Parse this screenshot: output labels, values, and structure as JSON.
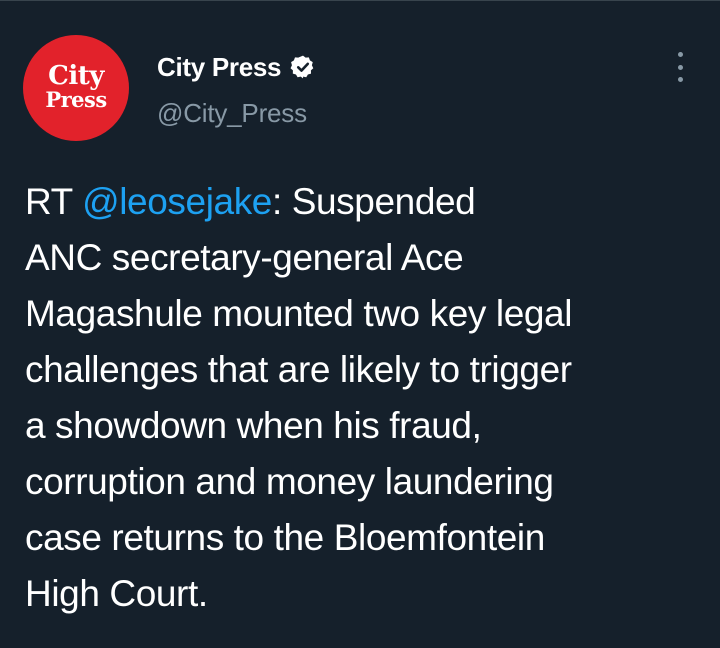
{
  "author": {
    "avatar_line1": "City",
    "avatar_line2": "Press",
    "display_name": "City Press",
    "handle": "@City_Press",
    "verified": true,
    "verified_icon": "verified-badge-icon"
  },
  "menu": {
    "icon": "more-vertical-icon"
  },
  "tweet": {
    "prefix": "RT ",
    "mention": "@leosejake",
    "after_mention": ": Suspended",
    "lines": [
      "ANC secretary-general Ace",
      "Magashule mounted two key legal",
      "challenges that are likely to trigger",
      "a showdown when his fraud,",
      "corruption and money laundering",
      "case returns to the Bloemfontein",
      "High Court."
    ]
  },
  "colors": {
    "background": "#15202b",
    "text": "#ffffff",
    "secondary_text": "#8899a6",
    "link": "#1da1f2",
    "avatar_red": "#e2222b"
  }
}
